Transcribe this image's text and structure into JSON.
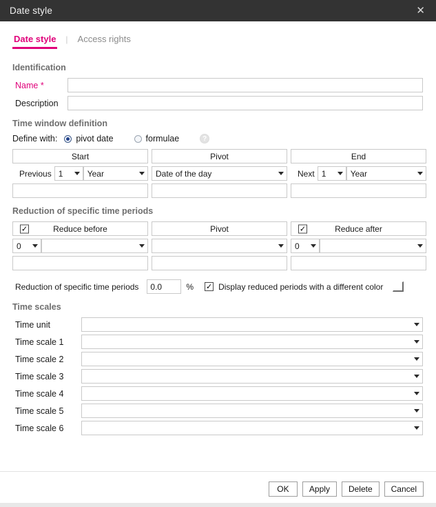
{
  "window": {
    "title": "Date style",
    "close_icon": "close-icon"
  },
  "tabs": {
    "separator": "|",
    "items": [
      {
        "label": "Date style",
        "active": true
      },
      {
        "label": "Access rights",
        "active": false
      }
    ]
  },
  "identification": {
    "section_title": "Identification",
    "name_label": "Name *",
    "name_value": "",
    "description_label": "Description",
    "description_value": ""
  },
  "time_window": {
    "section_title": "Time window definition",
    "define_with_label": "Define with:",
    "options": [
      {
        "label": "pivot date",
        "selected": true
      },
      {
        "label": "formulae",
        "selected": false
      }
    ],
    "help_icon": "?",
    "columns": [
      {
        "header": "Start",
        "prefix": "Previous",
        "count_value": "1",
        "unit_value": "Year",
        "extra_value": ""
      },
      {
        "header": "Pivot",
        "prefix": "",
        "count_value": "",
        "unit_value": "Date of the day",
        "extra_value": ""
      },
      {
        "header": "End",
        "prefix": "Next",
        "count_value": "1",
        "unit_value": "Year",
        "extra_value": ""
      }
    ]
  },
  "reduction": {
    "section_title": "Reduction of specific time periods",
    "columns": [
      {
        "header": "Reduce before",
        "checked": true,
        "count_value": "0",
        "select_value": "",
        "extra_value": ""
      },
      {
        "header": "Pivot",
        "checked": null,
        "count_value": "",
        "select_value": "",
        "extra_value": ""
      },
      {
        "header": "Reduce after",
        "checked": true,
        "count_value": "0",
        "select_value": "",
        "extra_value": ""
      }
    ],
    "summary_label": "Reduction of specific time periods",
    "summary_value": "0.0",
    "percent_symbol": "%",
    "display_color_checked": true,
    "display_color_label": "Display reduced periods with a different color",
    "color_swatch_value": "#ffffff"
  },
  "time_scales": {
    "section_title": "Time scales",
    "rows": [
      {
        "label": "Time unit",
        "value": ""
      },
      {
        "label": "Time scale 1",
        "value": ""
      },
      {
        "label": "Time scale 2",
        "value": ""
      },
      {
        "label": "Time scale 3",
        "value": ""
      },
      {
        "label": "Time scale 4",
        "value": ""
      },
      {
        "label": "Time scale 5",
        "value": ""
      },
      {
        "label": "Time scale 6",
        "value": ""
      }
    ]
  },
  "footer": {
    "buttons": [
      {
        "label": "OK"
      },
      {
        "label": "Apply"
      },
      {
        "label": "Delete"
      },
      {
        "label": "Cancel"
      }
    ]
  },
  "colors": {
    "accent": "#e0007a",
    "titlebar_bg": "#333333",
    "section_title": "#6e6e6e",
    "border": "#c9c9c9"
  }
}
